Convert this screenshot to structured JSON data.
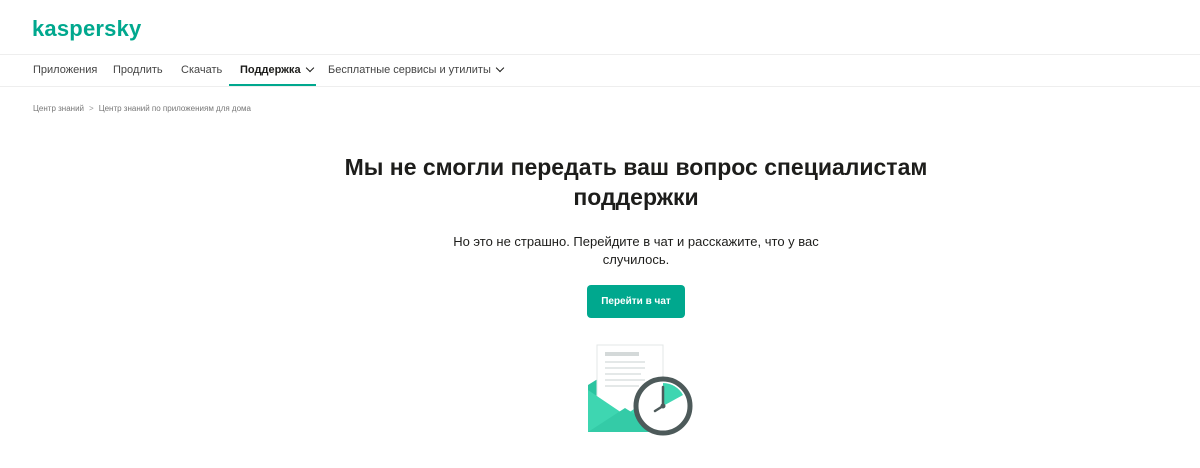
{
  "brand": {
    "logo_text": "kaspersky"
  },
  "nav": {
    "items": [
      {
        "label": "Приложения"
      },
      {
        "label": "Продлить"
      },
      {
        "label": "Скачать"
      },
      {
        "label": "Поддержка"
      },
      {
        "label": "Бесплатные сервисы и утилиты"
      }
    ]
  },
  "breadcrumb": {
    "items": [
      "Центр знаний",
      "Центр знаний по приложениям для дома"
    ],
    "separator": ">"
  },
  "main": {
    "title": "Мы не смогли передать ваш вопрос специалистам поддержки",
    "description": "Но это не страшно. Перейдите в чат и расскажите, что у вас случилось.",
    "button_label": "Перейти в чат"
  },
  "colors": {
    "accent": "#00a88e",
    "envelope": "#3ed6b1",
    "clock": "#4d5a5a"
  },
  "icons": {
    "illustration": "envelope-clock-icon",
    "caret": "chevron-down-icon"
  }
}
